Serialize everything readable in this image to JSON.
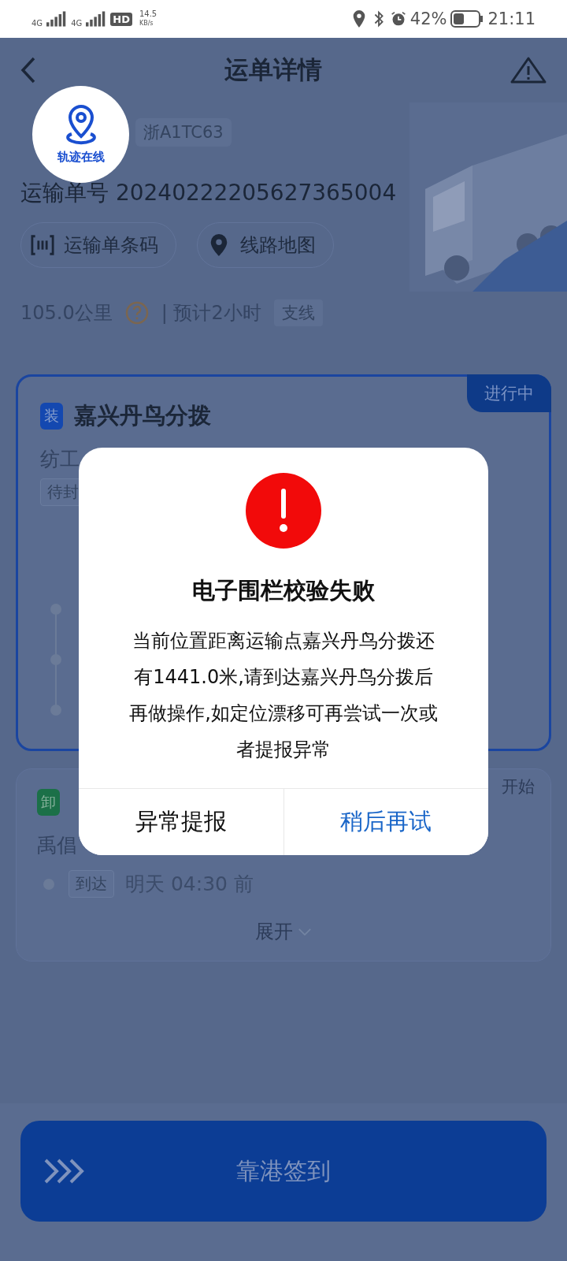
{
  "status_bar": {
    "net1": "4G",
    "net2": "4G",
    "hd": "HD",
    "speed": "14.5",
    "speed_unit": "KB/s",
    "battery": "42%",
    "time": "21:11"
  },
  "header": {
    "title": "运单详情"
  },
  "track_badge": {
    "label": "轨迹在线"
  },
  "plate": "浙A1TC63",
  "order": {
    "label": "运输单号",
    "number": "20240222205627365004"
  },
  "actions": [
    {
      "kind": "barcode",
      "label": "运输单条码"
    },
    {
      "kind": "map",
      "label": "线路地图"
    }
  ],
  "route_info": {
    "distance": "105.0公里",
    "eta": "| 预计2小时",
    "tag": "支线"
  },
  "stops": [
    {
      "kind": "load",
      "badge": "装",
      "name": "嘉兴丹鸟分拨",
      "status": "进行中",
      "address": "纺工",
      "tag": "待封",
      "active": true
    },
    {
      "kind": "unload",
      "badge": "卸",
      "status": "开始",
      "address": "禹倡",
      "step_tag": "到达",
      "time": "明天 04:30 前",
      "expand": "展开",
      "active": false
    }
  ],
  "dialog": {
    "title": "电子围栏校验失败",
    "message": "当前位置距离运输点嘉兴丹鸟分拨还有1441.0米,请到达嘉兴丹鸟分拨后再做操作,如定位漂移可再尝试一次或者提报异常",
    "buttons": [
      {
        "label": "异常提报",
        "primary": false
      },
      {
        "label": "稍后再试",
        "primary": true
      }
    ]
  },
  "bottom_button": {
    "label": "靠港签到"
  }
}
